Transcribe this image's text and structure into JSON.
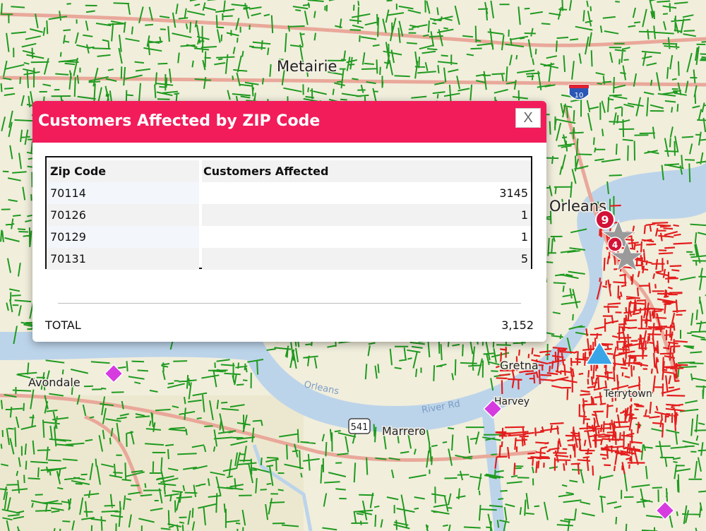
{
  "modal": {
    "title": "Customers Affected by ZIP Code",
    "close_label": "X",
    "columns": [
      "Zip Code",
      "Customers Affected"
    ],
    "rows": [
      {
        "zip": "70114",
        "customers": "3145"
      },
      {
        "zip": "70126",
        "customers": "1"
      },
      {
        "zip": "70129",
        "customers": "1"
      },
      {
        "zip": "70131",
        "customers": "5"
      }
    ],
    "total_label": "TOTAL",
    "total_value": "3,152"
  },
  "map": {
    "places": [
      "Metairie",
      "Orleans",
      "Gretna",
      "Avondale",
      "Marrero",
      "Harvey",
      "Terrytown"
    ],
    "river_labels": [
      "Orleans",
      "River Rd"
    ],
    "road_shields": [
      "541",
      "10"
    ],
    "cluster_badges": [
      "9",
      "4"
    ],
    "colors": {
      "land": "#f1eedc",
      "water": "#bcd4ea",
      "feeder_normal": "#1f9a1f",
      "feeder_outage": "#e41d1d",
      "major_road": "#e9a89a",
      "modal_header": "#f21c5b",
      "crew_marker": "#d63be0",
      "triangle_marker": "#3aa5e6",
      "star_marker": "#9a9a9a",
      "badge": "#d21236"
    },
    "markers": [
      "crew-diamond-icon",
      "crew-diamond-icon",
      "crew-diamond-icon",
      "triangle-icon",
      "star-icon",
      "star-icon"
    ]
  }
}
